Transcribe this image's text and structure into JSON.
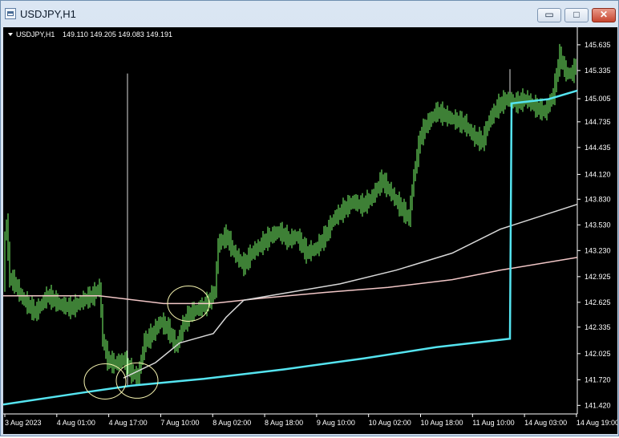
{
  "window": {
    "title": "USDJPY,H1",
    "minimize_label": "▭",
    "maximize_label": "□",
    "close_label": "✕"
  },
  "chart_info": {
    "symbol": "USDJPY,H1",
    "ohlc": "149.110 149.205 149.083 149.191"
  },
  "colors": {
    "background": "#000000",
    "candles": "#7cff6b",
    "ma_slow": "#f2c7c7",
    "ma_mid": "#d8d8d8",
    "ma_fast": "#55e4f0",
    "axis_text": "#ffffff",
    "circles": "#f6f4b0"
  },
  "chart_data": {
    "type": "line",
    "title": "USDJPY,H1",
    "ylim": [
      141.32,
      145.84
    ],
    "y_ticks": [
      "145.635",
      "145.335",
      "145.005",
      "144.735",
      "144.435",
      "144.120",
      "143.830",
      "143.530",
      "143.230",
      "142.925",
      "142.625",
      "142.335",
      "142.025",
      "141.720",
      "141.420"
    ],
    "x_ticks": [
      "3 Aug 2023",
      "4 Aug 01:00",
      "4 Aug 17:00",
      "7 Aug 10:00",
      "8 Aug 02:00",
      "8 Aug 18:00",
      "9 Aug 10:00",
      "10 Aug 02:00",
      "10 Aug 18:00",
      "11 Aug 10:00",
      "14 Aug 03:00",
      "14 Aug 19:00"
    ],
    "series": [
      {
        "key": "price",
        "values": [
          [
            0,
            142.8
          ],
          [
            3,
            143.7
          ],
          [
            8,
            142.9
          ],
          [
            14,
            142.85
          ],
          [
            22,
            142.7
          ],
          [
            30,
            142.6
          ],
          [
            40,
            142.5
          ],
          [
            55,
            142.7
          ],
          [
            70,
            142.6
          ],
          [
            85,
            142.55
          ],
          [
            100,
            142.65
          ],
          [
            112,
            142.7
          ],
          [
            120,
            142.8
          ],
          [
            124,
            142.2
          ],
          [
            130,
            141.95
          ],
          [
            138,
            141.9
          ],
          [
            150,
            141.95
          ],
          [
            160,
            141.8
          ],
          [
            168,
            141.75
          ],
          [
            176,
            142.15
          ],
          [
            186,
            142.25
          ],
          [
            196,
            142.4
          ],
          [
            206,
            142.3
          ],
          [
            216,
            142.1
          ],
          [
            224,
            142.35
          ],
          [
            234,
            142.5
          ],
          [
            244,
            142.55
          ],
          [
            254,
            142.6
          ],
          [
            264,
            142.75
          ],
          [
            268,
            143.3
          ],
          [
            278,
            143.4
          ],
          [
            288,
            143.2
          ],
          [
            300,
            143.05
          ],
          [
            310,
            143.2
          ],
          [
            322,
            143.3
          ],
          [
            334,
            143.4
          ],
          [
            344,
            143.45
          ],
          [
            356,
            143.35
          ],
          [
            366,
            143.4
          ],
          [
            378,
            143.2
          ],
          [
            390,
            143.25
          ],
          [
            402,
            143.4
          ],
          [
            412,
            143.6
          ],
          [
            424,
            143.7
          ],
          [
            436,
            143.8
          ],
          [
            448,
            143.75
          ],
          [
            460,
            143.85
          ],
          [
            472,
            144.05
          ],
          [
            484,
            143.9
          ],
          [
            494,
            143.75
          ],
          [
            506,
            143.6
          ],
          [
            512,
            144.1
          ],
          [
            520,
            144.55
          ],
          [
            528,
            144.7
          ],
          [
            540,
            144.85
          ],
          [
            552,
            144.8
          ],
          [
            564,
            144.75
          ],
          [
            576,
            144.7
          ],
          [
            588,
            144.55
          ],
          [
            598,
            144.5
          ],
          [
            606,
            144.75
          ],
          [
            616,
            144.9
          ],
          [
            628,
            145.0
          ],
          [
            640,
            144.95
          ],
          [
            652,
            145.0
          ],
          [
            664,
            144.9
          ],
          [
            676,
            144.85
          ],
          [
            686,
            145.05
          ],
          [
            694,
            145.5
          ],
          [
            702,
            145.3
          ],
          [
            710,
            145.3
          ],
          [
            716,
            145.45
          ]
        ]
      },
      {
        "key": "ma_slow",
        "values": [
          [
            0,
            142.7
          ],
          [
            120,
            142.7
          ],
          [
            200,
            142.61
          ],
          [
            260,
            142.61
          ],
          [
            320,
            142.67
          ],
          [
            400,
            142.74
          ],
          [
            480,
            142.8
          ],
          [
            560,
            142.89
          ],
          [
            620,
            143.0
          ],
          [
            716,
            143.15
          ]
        ]
      },
      {
        "key": "ma_mid",
        "values": [
          [
            150,
            141.74
          ],
          [
            190,
            141.92
          ],
          [
            220,
            142.15
          ],
          [
            262,
            142.26
          ],
          [
            278,
            142.45
          ],
          [
            300,
            142.65
          ],
          [
            350,
            142.73
          ],
          [
            420,
            142.84
          ],
          [
            490,
            143.0
          ],
          [
            560,
            143.2
          ],
          [
            620,
            143.48
          ],
          [
            716,
            143.77
          ]
        ]
      },
      {
        "key": "ma_fast",
        "values": [
          [
            0,
            141.43
          ],
          [
            100,
            141.57
          ],
          [
            160,
            141.65
          ],
          [
            250,
            141.73
          ],
          [
            350,
            141.84
          ],
          [
            450,
            141.97
          ],
          [
            540,
            142.1
          ],
          [
            632,
            142.2
          ],
          [
            634,
            144.95
          ],
          [
            680,
            145.0
          ],
          [
            716,
            145.1
          ]
        ]
      }
    ],
    "spikes": [
      [
        155,
        141.65,
        145.3
      ],
      [
        632,
        144.95,
        145.35
      ]
    ],
    "ellipses": [
      [
        127,
        141.7
      ],
      [
        167,
        141.71
      ],
      [
        231,
        142.61
      ]
    ],
    "grid": false
  }
}
